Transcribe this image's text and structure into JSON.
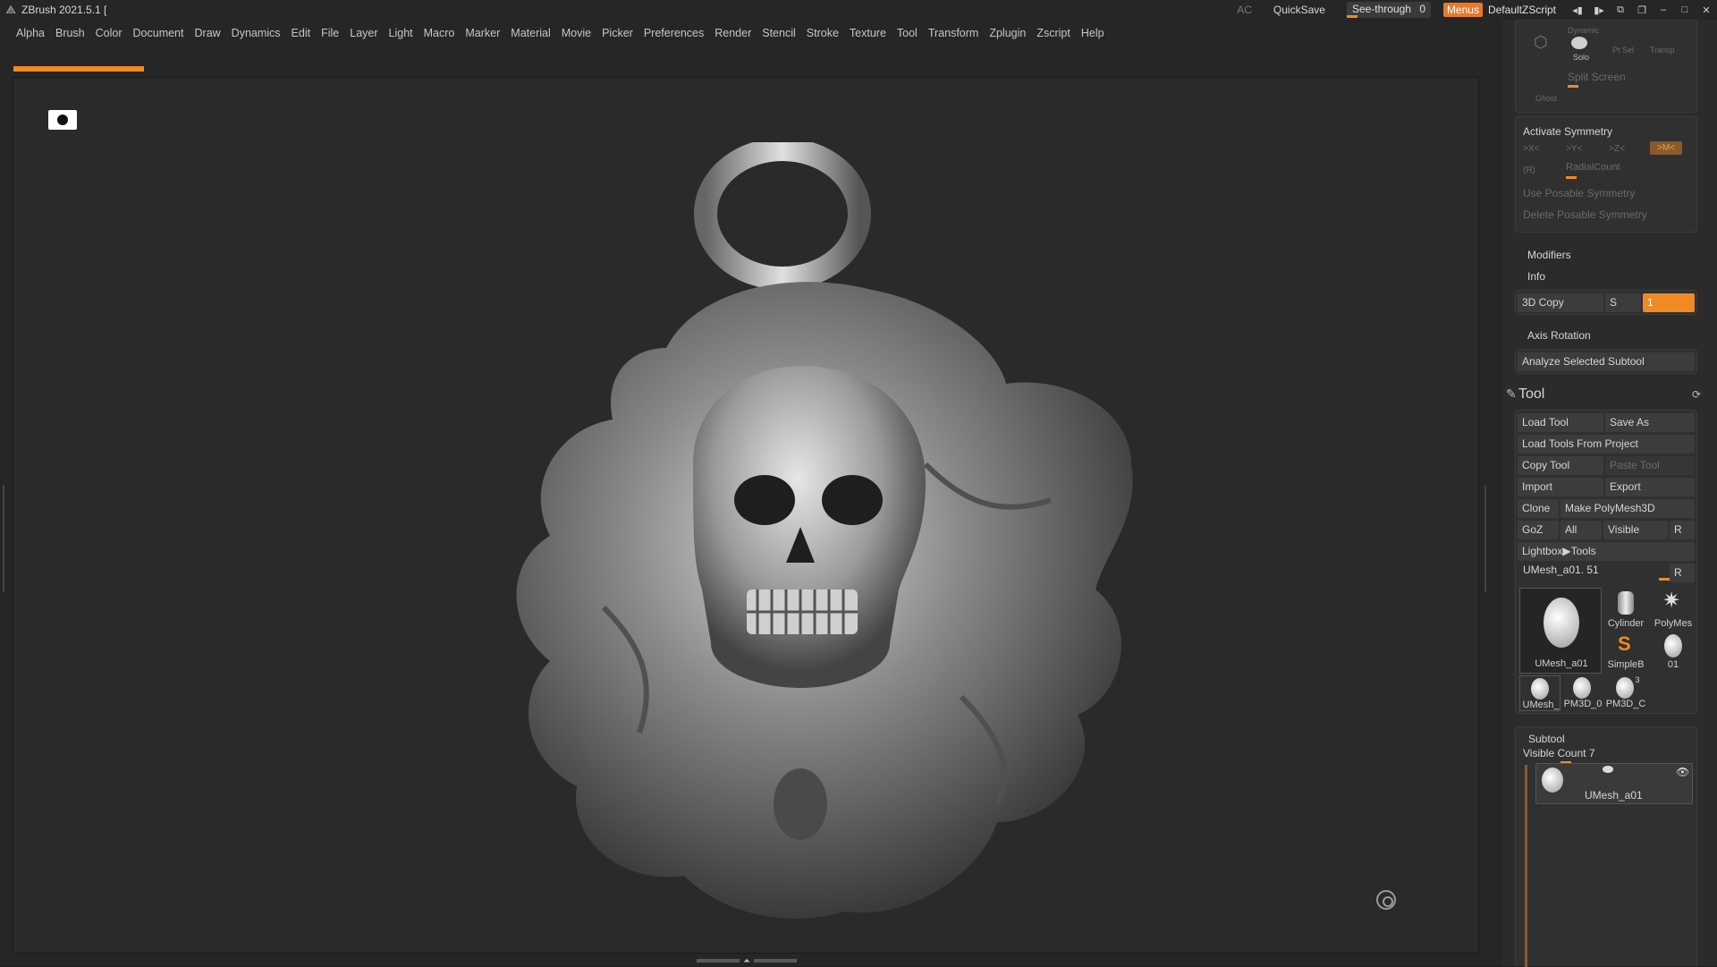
{
  "app": {
    "title": "ZBrush 2021.5.1 ["
  },
  "titlebar": {
    "ac": "AC",
    "quicksave": "QuickSave",
    "see_through_label": "See-through",
    "see_through_value": "0",
    "see_through_fraction": 0.0,
    "menus": "Menus",
    "script": "DefaultZScript"
  },
  "menu": [
    "Alpha",
    "Brush",
    "Color",
    "Document",
    "Draw",
    "Dynamics",
    "Edit",
    "File",
    "Layer",
    "Light",
    "Macro",
    "Marker",
    "Material",
    "Movie",
    "Picker",
    "Preferences",
    "Render",
    "Stencil",
    "Stroke",
    "Texture",
    "Tool",
    "Transform",
    "Zplugin",
    "Zscript",
    "Help"
  ],
  "top_panel": {
    "dynamic": "Dynamic",
    "solo": "Solo",
    "ptsel": "Pt Sel",
    "transp": "Transp",
    "ghost": "Ghost",
    "split_screen": "Split Screen"
  },
  "symmetry": {
    "title": "Activate Symmetry",
    "x": ">X<",
    "y": ">Y<",
    "z": ">Z<",
    "m": ">M<",
    "r": "(R)",
    "radial_count": "RadialCount",
    "use_posable": "Use Posable Symmetry",
    "delete_posable": "Delete Posable Symmetry"
  },
  "sections": {
    "modifiers": "Modifiers",
    "info": "Info",
    "copy3d": "3D Copy",
    "s": "S",
    "copy_value": "1",
    "axis_rotation": "Axis Rotation",
    "analyze": "Analyze Selected Subtool"
  },
  "tool": {
    "title": "Tool",
    "load_tool": "Load Tool",
    "save_as": "Save As",
    "load_from_project": "Load Tools From Project",
    "copy_tool": "Copy Tool",
    "paste_tool": "Paste Tool",
    "import": "Import",
    "export": "Export",
    "clone": "Clone",
    "make_polymesh": "Make PolyMesh3D",
    "goz": "GoZ",
    "all": "All",
    "visible": "Visible",
    "r": "R",
    "lightbox": "Lightbox▶Tools",
    "current": "UMesh_a01. 51",
    "thumbs": {
      "main": "UMesh_a01",
      "cylinder": "Cylinder",
      "polymesh": "PolyMes",
      "simpleb": "SimpleB",
      "t01": "01",
      "umesh": "UMesh_",
      "pm3d_0": "PM3D_0",
      "pm3d_c": "PM3D_C",
      "num3": "3"
    }
  },
  "subtool": {
    "title": "Subtool",
    "visible_count": "Visible Count 7",
    "item": "UMesh_a01"
  },
  "colors": {
    "accent": "#f08a24",
    "panel": "#2b2b2b",
    "canvas": "#2a2a2a"
  },
  "icons": [
    "zbrush-logo-icon",
    "camera-icon",
    "target-icon",
    "refresh-icon",
    "brush-tool-icon",
    "eye-icon"
  ]
}
